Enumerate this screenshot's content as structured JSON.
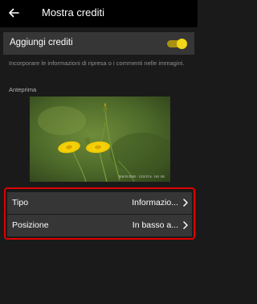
{
  "header": {
    "title": "Mostra crediti"
  },
  "credits_toggle": {
    "label": "Aggiungi crediti",
    "enabled": true
  },
  "description": "Incorporare le informazioni di ripresa o i commenti nelle immagini.",
  "preview": {
    "label": "Anteprima",
    "watermark": "NIKON D500 · 1/250 F5.6 · ISO 100"
  },
  "settings": [
    {
      "label": "Tipo",
      "value": "Informazio..."
    },
    {
      "label": "Posizione",
      "value": "In basso a..."
    }
  ],
  "colors": {
    "header_bg": "#000000",
    "page_bg": "#1a1a1a",
    "row_bg": "#363636",
    "toggle_accent": "#f2d619",
    "highlight_border": "#e00000"
  }
}
